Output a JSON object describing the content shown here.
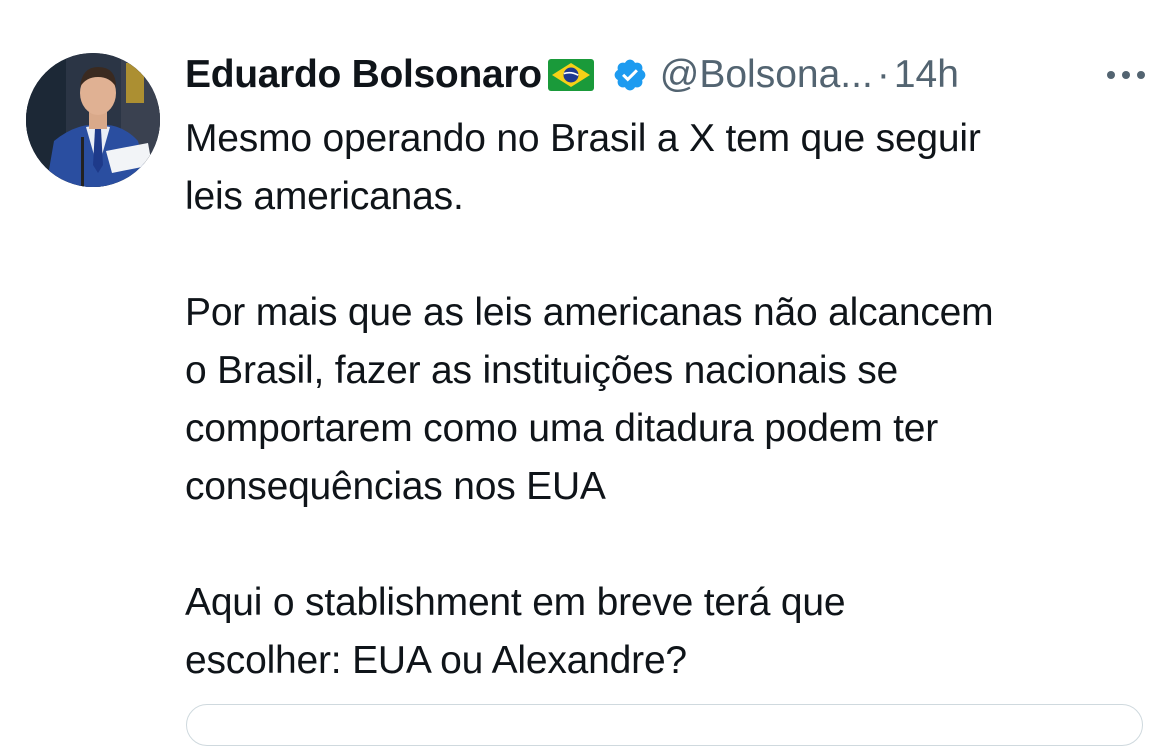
{
  "tweet": {
    "display_name": "Eduardo Bolsonaro",
    "handle": "@Bolsona...",
    "separator": "·",
    "time": "14h",
    "flag_icon": "brazil-flag-icon",
    "verified_icon": "verified-badge-icon",
    "verified_color": "#1d9bf0",
    "more_icon": "more-horizontal-icon",
    "paragraphs": [
      [
        "Mesmo operando no Brasil a X tem que seguir",
        "leis americanas."
      ],
      [
        "Por mais que as leis americanas não alcancem",
        "o Brasil, fazer as instituições nacionais se",
        "comportarem como uma ditadura podem ter",
        "consequências nos EUA"
      ],
      [
        "Aqui o stablishment em breve terá que",
        "escolher: EUA ou Alexandre?"
      ]
    ]
  },
  "colors": {
    "text": "#0f1419",
    "secondary": "#536471",
    "border": "#cfd9de",
    "background": "#ffffff"
  }
}
